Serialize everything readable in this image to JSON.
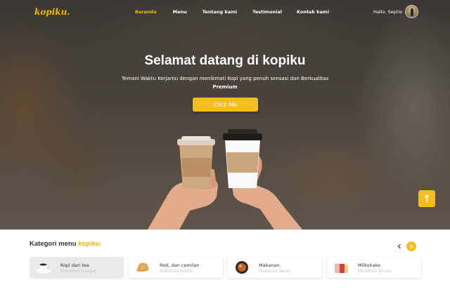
{
  "brand": {
    "logo": "kopiku."
  },
  "nav": {
    "items": [
      "Beranda",
      "Menu",
      "Tentang kami",
      "Testimonial",
      "Kontak kami"
    ],
    "active": "Beranda"
  },
  "user": {
    "greeting": "Hallo, Septio"
  },
  "hero": {
    "title": "Selamat datang di kopiku",
    "subtitle_line1": "Temani Waktu Kerjamu dengan menikmati Kopi yang penuh sensasi dan Berkualitas",
    "subtitle_bold": "Premium",
    "cta_label": "Click Me"
  },
  "categories": {
    "heading_prefix": "Kategori menu",
    "heading_brand": "kopiku.",
    "prev_icon": "chevron-left-icon",
    "next_icon": "chevron-right-icon",
    "items": [
      {
        "title": "Kopi dan tea",
        "subtitle": "Minuman hangat",
        "icon": "coffee-cup-icon",
        "selected": true
      },
      {
        "title": "Roti, dan cemilan",
        "subtitle": "Makanan manis",
        "icon": "bread-icon",
        "selected": false
      },
      {
        "title": "Makanan",
        "subtitle": "Makanan berat",
        "icon": "food-bowl-icon",
        "selected": false
      },
      {
        "title": "Milkshake",
        "subtitle": "Minuman dingin",
        "icon": "milkshake-icon",
        "selected": false
      }
    ]
  },
  "colors": {
    "accent": "#f5bd25",
    "logo": "#f5b700",
    "text_dark": "#333333",
    "text_muted": "#c4c4c4"
  },
  "scroll_top_icon": "arrow-up-icon"
}
